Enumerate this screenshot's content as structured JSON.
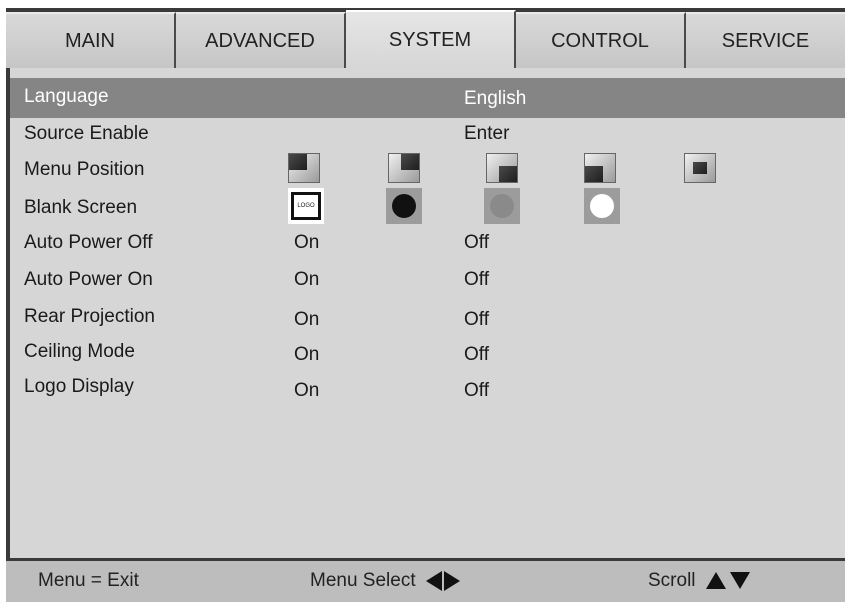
{
  "tabs": [
    {
      "label": "MAIN",
      "active": false
    },
    {
      "label": "ADVANCED",
      "active": false
    },
    {
      "label": "SYSTEM",
      "active": true
    },
    {
      "label": "CONTROL",
      "active": false
    },
    {
      "label": "SERVICE",
      "active": false
    }
  ],
  "menu": {
    "language": {
      "label": "Language",
      "value": "English"
    },
    "source_enable": {
      "label": "Source Enable",
      "value": "Enter"
    },
    "menu_position": {
      "label": "Menu Position",
      "icons": [
        "top-left-position-icon",
        "top-right-position-icon",
        "bottom-right-position-icon",
        "bottom-left-position-icon",
        "center-position-icon"
      ]
    },
    "blank_screen": {
      "label": "Blank Screen",
      "logo_text": "LOGO",
      "icons": [
        "logo-icon",
        "black-icon",
        "gray-icon",
        "white-icon"
      ]
    },
    "auto_power_off": {
      "label": "Auto Power Off",
      "on": "On",
      "off": "Off"
    },
    "auto_power_on": {
      "label": "Auto Power On",
      "on": "On",
      "off": "Off"
    },
    "rear_projection": {
      "label": "Rear Projection",
      "on": "On",
      "off": "Off"
    },
    "ceiling_mode": {
      "label": "Ceiling Mode",
      "on": "On",
      "off": "Off"
    },
    "logo_display": {
      "label": "Logo Display",
      "on": "On",
      "off": "Off"
    }
  },
  "footer": {
    "exit": "Menu = Exit",
    "select": "Menu Select",
    "scroll": "Scroll"
  },
  "colors": {
    "background": "#d6d6d6",
    "highlight": "#858585",
    "border": "#3a3a3a"
  }
}
